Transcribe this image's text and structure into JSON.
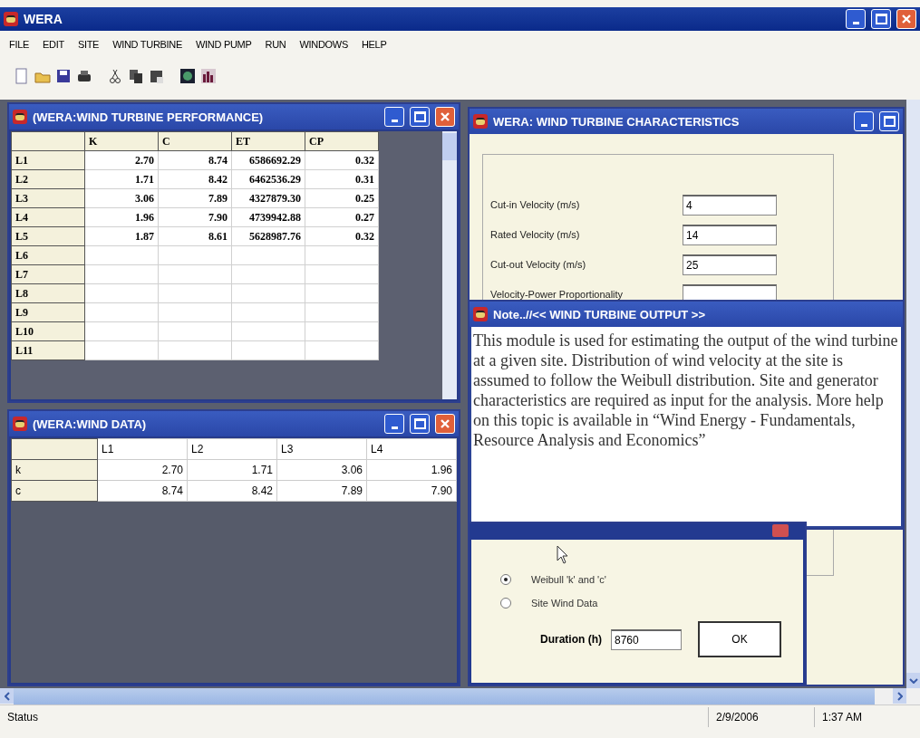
{
  "window": {
    "title": "WERA"
  },
  "menu": [
    "FILE",
    "EDIT",
    "SITE",
    "WIND TURBINE",
    "WIND PUMP",
    "RUN",
    "WINDOWS",
    "HELP"
  ],
  "performance_window": {
    "title": "(WERA:WIND TURBINE PERFORMANCE)",
    "columns": [
      "K",
      "C",
      "ET",
      "CP"
    ],
    "rows": [
      {
        "label": "L1",
        "cells": [
          "2.70",
          "8.74",
          "6586692.29",
          "0.32"
        ]
      },
      {
        "label": "L2",
        "cells": [
          "1.71",
          "8.42",
          "6462536.29",
          "0.31"
        ]
      },
      {
        "label": "L3",
        "cells": [
          "3.06",
          "7.89",
          "4327879.30",
          "0.25"
        ]
      },
      {
        "label": "L4",
        "cells": [
          "1.96",
          "7.90",
          "4739942.88",
          "0.27"
        ]
      },
      {
        "label": "L5",
        "cells": [
          "1.87",
          "8.61",
          "5628987.76",
          "0.32"
        ]
      },
      {
        "label": "L6"
      },
      {
        "label": "L7"
      },
      {
        "label": "L8"
      },
      {
        "label": "L9"
      },
      {
        "label": "L10"
      },
      {
        "label": "L11"
      }
    ]
  },
  "wind_data_window": {
    "title": "(WERA:WIND DATA)",
    "columns": [
      "L1",
      "L2",
      "L3",
      "L4"
    ],
    "rows": [
      {
        "label": "k",
        "cells": [
          "2.70",
          "1.71",
          "3.06",
          "1.96"
        ]
      },
      {
        "label": "c",
        "cells": [
          "8.74",
          "8.42",
          "7.89",
          "7.90"
        ]
      }
    ]
  },
  "characteristics_window": {
    "title": "WERA: WIND TURBINE CHARACTERISTICS",
    "fields": [
      {
        "label": "Cut-in Velocity (m/s)",
        "value": "4"
      },
      {
        "label": "Rated Velocity (m/s)",
        "value": "14"
      },
      {
        "label": "Cut-out Velocity (m/s)",
        "value": "25"
      },
      {
        "label": "Velocity-Power Proportionality"
      }
    ]
  },
  "note_window": {
    "title": "Note..//<< WIND TURBINE OUTPUT >>",
    "text": "This module is used for estimating the output of the wind turbine at a given site. Distribution of wind velocity at the site is assumed to follow the Weibull distribution. Site and generator characteristics are required as input for the analysis. More help on this topic is available in “Wind Energy - Fundamentals, Resource Analysis and Economics”"
  },
  "input_dialog": {
    "options": [
      {
        "label": "Weibull 'k' and 'c'",
        "selected": true
      },
      {
        "label": "Site Wind Data",
        "selected": false
      }
    ],
    "duration": {
      "label": "Duration (h)",
      "value": "8760"
    },
    "ok": "OK"
  },
  "status_bar": {
    "status": "Status",
    "date": "2/9/2006",
    "time": "1:37 AM"
  }
}
